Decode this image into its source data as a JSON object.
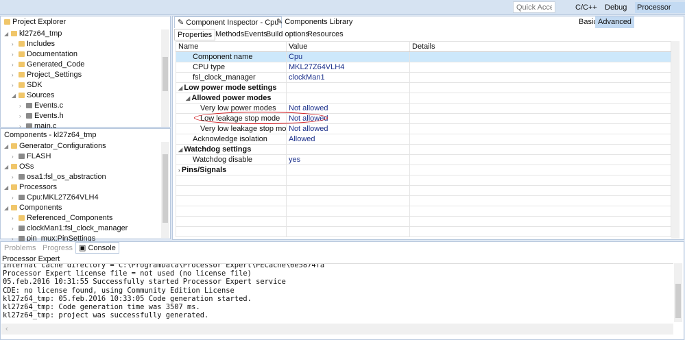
{
  "toolbar": {
    "quick_access_placeholder": "Quick Access",
    "perspectives": [
      "C/C++",
      "Debug",
      "Processor Expert"
    ]
  },
  "project_explorer": {
    "title": "Project Explorer",
    "items": [
      {
        "label": "kl27z64_tmp",
        "level": 0,
        "expanded": true
      },
      {
        "label": "Includes",
        "level": 1
      },
      {
        "label": "Documentation",
        "level": 1
      },
      {
        "label": "Generated_Code",
        "level": 1
      },
      {
        "label": "Project_Settings",
        "level": 1
      },
      {
        "label": "SDK",
        "level": 1
      },
      {
        "label": "Sources",
        "level": 1,
        "expanded": true
      },
      {
        "label": "Events.c",
        "level": 2
      },
      {
        "label": "Events.h",
        "level": 2
      },
      {
        "label": "main.c",
        "level": 2
      }
    ]
  },
  "components": {
    "title": "Components - kl27z64_tmp",
    "items": [
      {
        "label": "Generator_Configurations",
        "level": 0,
        "expanded": true
      },
      {
        "label": "FLASH",
        "level": 1
      },
      {
        "label": "OSs",
        "level": 0,
        "expanded": true
      },
      {
        "label": "osa1:fsl_os_abstraction",
        "level": 1
      },
      {
        "label": "Processors",
        "level": 0,
        "expanded": true
      },
      {
        "label": "Cpu:MKL27Z64VLH4",
        "level": 1
      },
      {
        "label": "Components",
        "level": 0,
        "expanded": true
      },
      {
        "label": "Referenced_Components",
        "level": 1
      },
      {
        "label": "clockMan1:fsl_clock_manager",
        "level": 1
      },
      {
        "label": "pin_mux:PinSettings",
        "level": 1
      }
    ]
  },
  "inspector": {
    "tabs": [
      "Component Inspector - Cpu",
      "Components Library"
    ],
    "mode_basic": "Basic",
    "mode_advanced": "Advanced",
    "subtabs": [
      "Properties",
      "Methods",
      "Events",
      "Build options",
      "Resources"
    ],
    "columns": [
      "Name",
      "Value",
      "Details"
    ],
    "rows": [
      {
        "name": "Component name",
        "value": "Cpu",
        "indent": 1,
        "selected": true
      },
      {
        "name": "CPU type",
        "value": "MKL27Z64VLH4",
        "indent": 1
      },
      {
        "name": "fsl_clock_manager",
        "value": "clockMan1",
        "indent": 1
      },
      {
        "name": "Low power mode settings",
        "value": "",
        "indent": 0,
        "group": true
      },
      {
        "name": "Allowed power modes",
        "value": "",
        "indent": 1,
        "group": true
      },
      {
        "name": "Very low power modes",
        "value": "Not allowed",
        "indent": 2
      },
      {
        "name": "Low leakage stop mode",
        "value": "Not allowed",
        "indent": 2,
        "highlighted": true
      },
      {
        "name": "Very low leakage stop mode",
        "value": "Not allowed",
        "indent": 2
      },
      {
        "name": "Acknowledge isolation",
        "value": "Allowed",
        "indent": 1
      },
      {
        "name": "Watchdog settings",
        "value": "",
        "indent": 0,
        "group": true
      },
      {
        "name": "Watchdog disable",
        "value": "yes",
        "indent": 1
      },
      {
        "name": "Pins/Signals",
        "value": "",
        "indent": 0,
        "group": true,
        "collapsed": true
      }
    ]
  },
  "console": {
    "tabs": [
      "Problems",
      "Progress",
      "Console"
    ],
    "title": "Processor Expert",
    "lines": [
      "Internal cache directory = C:\\ProgramData\\Processor Expert\\PECache\\6e5874fa",
      "Processor Expert license file = not used (no license file)",
      "05.feb.2016 10:31:55 Successfully started Processor Expert service",
      "CDE: no license found, using Community Edition License",
      "kl27z64_tmp: 05.feb.2016 10:33:05 Code generation started.",
      "kl27z64_tmp: Code generation time was 3507 ms.",
      "kl27z64_tmp: project was successfully generated."
    ]
  },
  "colors": {
    "highlight_circle": "#d0161b",
    "selected_row": "#cde8fb",
    "value_text": "#1a2f8a"
  }
}
